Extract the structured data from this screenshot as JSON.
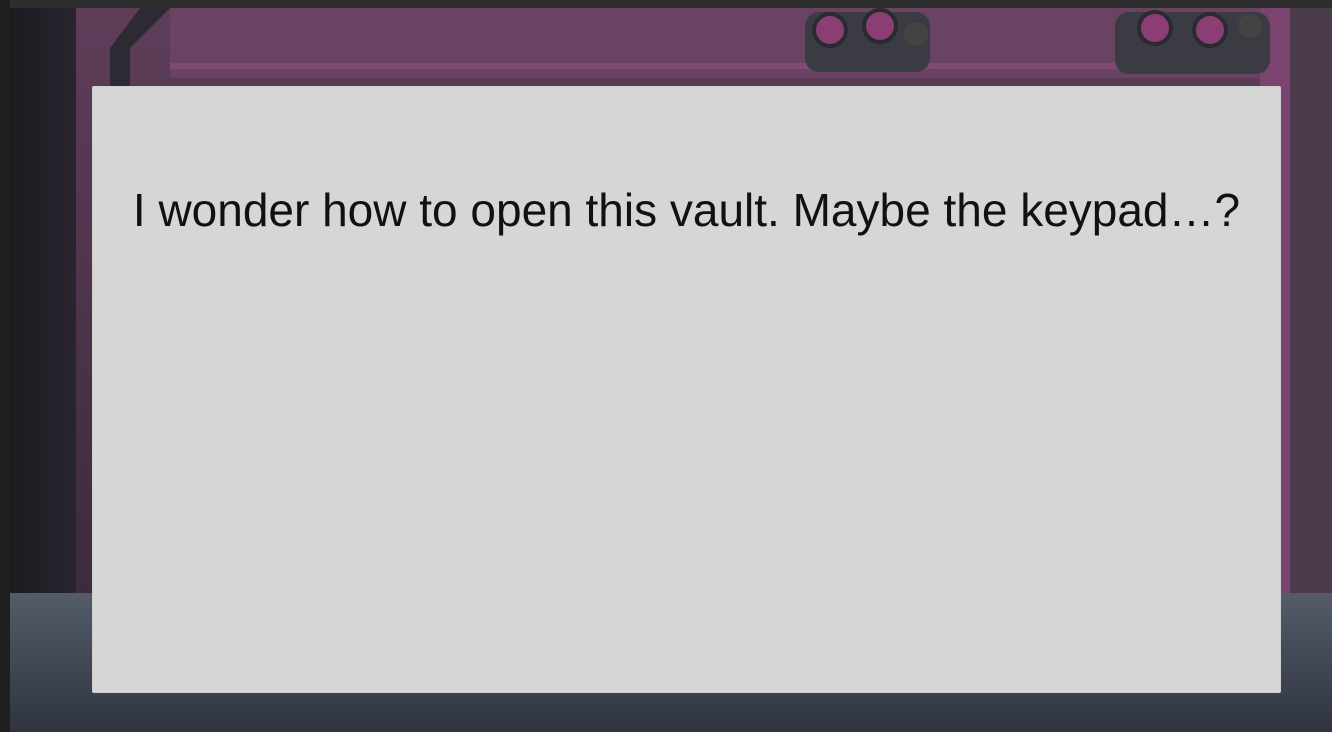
{
  "dialog": {
    "message": "I wonder how to open this vault. Maybe the keypad…?"
  },
  "scene": {
    "description_colors": {
      "wall": "#5a3a55",
      "wall_light": "#6e4766",
      "trim": "#8a3f74",
      "floor": "#4c5462",
      "dialog_bg": "#d6d6d6",
      "text": "#111111"
    }
  }
}
